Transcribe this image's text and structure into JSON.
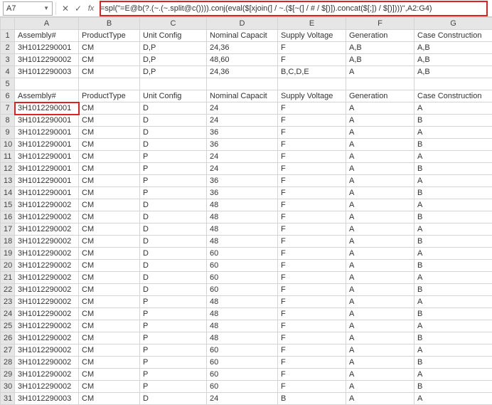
{
  "formula_bar": {
    "name_box": "A7",
    "cancel_icon": "✕",
    "accept_icon": "✓",
    "fx_label": "fx",
    "formula": "=spl(\"=E@b(?.(~.(~.split@c()))).conj(eval($[xjoin(] / ~.($[~(] / # / $[)]).concat($[;]) / $[)])))\",A2:G4)"
  },
  "columns": [
    "A",
    "B",
    "C",
    "D",
    "E",
    "F",
    "G"
  ],
  "headers": [
    "Assembly#",
    "ProductType",
    "Unit Config",
    "Nominal Capacit",
    "Supply Voltage",
    "Generation",
    "Case Construction"
  ],
  "top_rows": [
    [
      "3H1012290001",
      "CM",
      "D,P",
      "24,36",
      "F",
      "A,B",
      "A,B"
    ],
    [
      "3H1012290002",
      "CM",
      "D,P",
      "48,60",
      "F",
      "A,B",
      "A,B"
    ],
    [
      "3H1012290003",
      "CM",
      "D,P",
      "24,36",
      "B,C,D,E",
      "A",
      "A,B"
    ]
  ],
  "blank_row": [
    "",
    "",
    "",
    "",
    "",
    "",
    ""
  ],
  "headers2": [
    "Assembly#",
    "ProductType",
    "Unit Config",
    "Nominal Capacit",
    "Supply Voltage",
    "Generation",
    "Case Construction"
  ],
  "data_rows": [
    [
      "3H1012290001",
      "CM",
      "D",
      "24",
      "F",
      "A",
      "A"
    ],
    [
      "3H1012290001",
      "CM",
      "D",
      "24",
      "F",
      "A",
      "B"
    ],
    [
      "3H1012290001",
      "CM",
      "D",
      "36",
      "F",
      "A",
      "A"
    ],
    [
      "3H1012290001",
      "CM",
      "D",
      "36",
      "F",
      "A",
      "B"
    ],
    [
      "3H1012290001",
      "CM",
      "P",
      "24",
      "F",
      "A",
      "A"
    ],
    [
      "3H1012290001",
      "CM",
      "P",
      "24",
      "F",
      "A",
      "B"
    ],
    [
      "3H1012290001",
      "CM",
      "P",
      "36",
      "F",
      "A",
      "A"
    ],
    [
      "3H1012290001",
      "CM",
      "P",
      "36",
      "F",
      "A",
      "B"
    ],
    [
      "3H1012290002",
      "CM",
      "D",
      "48",
      "F",
      "A",
      "A"
    ],
    [
      "3H1012290002",
      "CM",
      "D",
      "48",
      "F",
      "A",
      "B"
    ],
    [
      "3H1012290002",
      "CM",
      "D",
      "48",
      "F",
      "A",
      "A"
    ],
    [
      "3H1012290002",
      "CM",
      "D",
      "48",
      "F",
      "A",
      "B"
    ],
    [
      "3H1012290002",
      "CM",
      "D",
      "60",
      "F",
      "A",
      "A"
    ],
    [
      "3H1012290002",
      "CM",
      "D",
      "60",
      "F",
      "A",
      "B"
    ],
    [
      "3H1012290002",
      "CM",
      "D",
      "60",
      "F",
      "A",
      "A"
    ],
    [
      "3H1012290002",
      "CM",
      "D",
      "60",
      "F",
      "A",
      "B"
    ],
    [
      "3H1012290002",
      "CM",
      "P",
      "48",
      "F",
      "A",
      "A"
    ],
    [
      "3H1012290002",
      "CM",
      "P",
      "48",
      "F",
      "A",
      "B"
    ],
    [
      "3H1012290002",
      "CM",
      "P",
      "48",
      "F",
      "A",
      "A"
    ],
    [
      "3H1012290002",
      "CM",
      "P",
      "48",
      "F",
      "A",
      "B"
    ],
    [
      "3H1012290002",
      "CM",
      "P",
      "60",
      "F",
      "A",
      "A"
    ],
    [
      "3H1012290002",
      "CM",
      "P",
      "60",
      "F",
      "A",
      "B"
    ],
    [
      "3H1012290002",
      "CM",
      "P",
      "60",
      "F",
      "A",
      "A"
    ],
    [
      "3H1012290002",
      "CM",
      "P",
      "60",
      "F",
      "A",
      "B"
    ],
    [
      "3H1012290003",
      "CM",
      "D",
      "24",
      "B",
      "A",
      "A"
    ]
  ]
}
